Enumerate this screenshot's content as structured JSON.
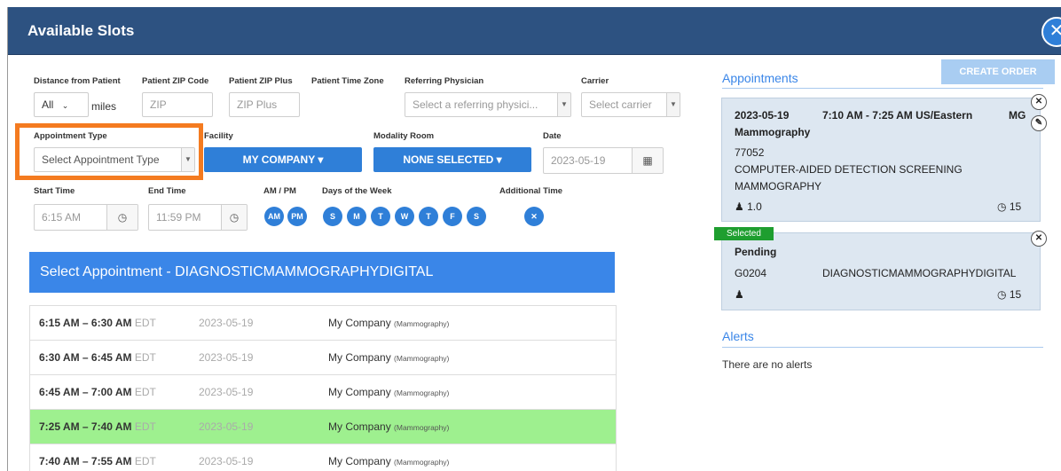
{
  "window": {
    "title": "Available Slots",
    "close_glyph": "✕"
  },
  "filters": {
    "distance_label": "Distance from Patient",
    "distance_value": "All",
    "distance_unit": "miles",
    "zip_label": "Patient ZIP Code",
    "zip_placeholder": "ZIP",
    "zip_plus_label": "Patient ZIP Plus",
    "zip_plus_placeholder": "ZIP Plus",
    "timezone_label": "Patient Time Zone",
    "physician_label": "Referring Physician",
    "physician_placeholder": "Select a referring physici...",
    "carrier_label": "Carrier",
    "carrier_placeholder": "Select carrier",
    "appt_type_label": "Appointment Type",
    "appt_type_placeholder": "Select Appointment Type",
    "facility_label": "Facility",
    "facility_value": "MY COMPANY ▾",
    "modality_label": "Modality Room",
    "modality_value": "NONE SELECTED ▾",
    "date_label": "Date",
    "date_value": "2023-05-19",
    "start_label": "Start Time",
    "start_value": "6:15 AM",
    "end_label": "End Time",
    "end_value": "11:59 PM",
    "ampm_label": "AM / PM",
    "am": "AM",
    "pm": "PM",
    "days_label": "Days of the Week",
    "days": [
      "S",
      "M",
      "T",
      "W",
      "T",
      "F",
      "S"
    ],
    "additional_label": "Additional Time",
    "additional_glyph": "✕"
  },
  "icons": {
    "calendar": "calendar-icon",
    "clock": "alarm-clock-icon",
    "dropdown": "caret-down-icon"
  },
  "slots": {
    "header": "Select Appointment - DIAGNOSTICMAMMOGRAPHYDIGITAL",
    "rows": [
      {
        "time": "6:15 AM – 6:30 AM",
        "tz": "EDT",
        "date": "2023-05-19",
        "facility": "My Company",
        "modality": "(Mammography)",
        "selected": false
      },
      {
        "time": "6:30 AM – 6:45 AM",
        "tz": "EDT",
        "date": "2023-05-19",
        "facility": "My Company",
        "modality": "(Mammography)",
        "selected": false
      },
      {
        "time": "6:45 AM – 7:00 AM",
        "tz": "EDT",
        "date": "2023-05-19",
        "facility": "My Company",
        "modality": "(Mammography)",
        "selected": false
      },
      {
        "time": "7:25 AM – 7:40 AM",
        "tz": "EDT",
        "date": "2023-05-19",
        "facility": "My Company",
        "modality": "(Mammography)",
        "selected": true
      },
      {
        "time": "7:40 AM – 7:55 AM",
        "tz": "EDT",
        "date": "2023-05-19",
        "facility": "My Company",
        "modality": "(Mammography)",
        "selected": false
      }
    ]
  },
  "right": {
    "create_order": "CREATE ORDER",
    "appointments_title": "Appointments",
    "card1": {
      "date": "2023-05-19",
      "time": "7:10 AM - 7:25 AM US/Eastern",
      "code": "MG",
      "modality": "Mammography",
      "cpt": "77052",
      "desc1": "COMPUTER-AIDED DETECTION SCREENING",
      "desc2": "MAMMOGRAPHY",
      "rvu": "1.0",
      "minutes": "15"
    },
    "card2": {
      "badge": "Selected",
      "status": "Pending",
      "cpt": "G0204",
      "desc": "DIAGNOSTICMAMMOGRAPHYDIGITAL",
      "minutes": "15"
    },
    "alerts_title": "Alerts",
    "alerts_text": "There are no alerts"
  },
  "colors": {
    "titlebar": "#2d5281",
    "accent": "#2f7fd8",
    "selected_row": "#9ef08f",
    "highlight": "#f47b20",
    "badge": "#1e9e2f"
  }
}
